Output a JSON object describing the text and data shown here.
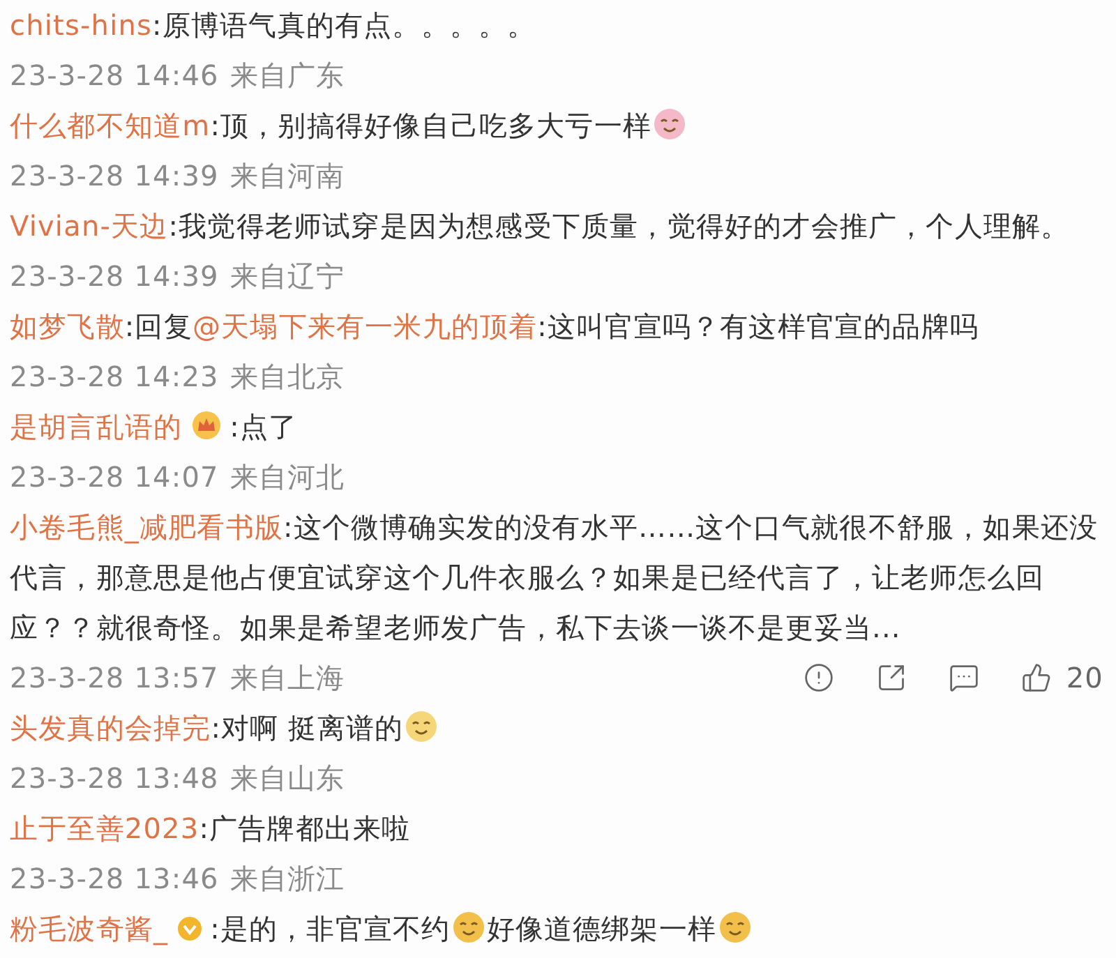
{
  "comments": [
    {
      "user": "chits-hins",
      "content": [
        {
          "kind": "text",
          "text": ":原博语气真的有点。。。。。"
        }
      ],
      "time": "23-3-28 14:46",
      "location": "来自广东"
    },
    {
      "user": "什么都不知道m",
      "content": [
        {
          "kind": "text",
          "text": ":顶，别搞得好像自己吃多大亏一样"
        },
        {
          "kind": "emoji",
          "color": "#f4b8c8"
        }
      ],
      "time": "23-3-28 14:39",
      "location": "来自河南"
    },
    {
      "user": "Vivian-天边",
      "content": [
        {
          "kind": "text",
          "text": ":我觉得老师试穿是因为想感受下质量，觉得好的才会推广，个人理解。"
        }
      ],
      "time": "23-3-28 14:39",
      "location": "来自辽宁"
    },
    {
      "user": "如梦飞散",
      "content": [
        {
          "kind": "text",
          "text": ":回复"
        },
        {
          "kind": "mention",
          "text": "@天塌下来有一米九的顶着"
        },
        {
          "kind": "text",
          "text": ":这叫官宣吗？有这样官宣的品牌吗"
        }
      ],
      "time": "23-3-28 14:23",
      "location": "来自北京"
    },
    {
      "user": "是胡言乱语的",
      "content": [
        {
          "kind": "crown"
        },
        {
          "kind": "text",
          "text": ":点了"
        }
      ],
      "time": "23-3-28 14:07",
      "location": "来自河北"
    },
    {
      "user": "小卷毛熊_减肥看书版",
      "content": [
        {
          "kind": "text",
          "text": ":这个微博确实发的没有水平……这个口气就很不舒服，如果还没代言，那意思是他占便宜试穿这个几件衣服么？如果是已经代言了，让老师怎么回应？？就很奇怪。如果是希望老师发广告，私下去谈一谈不是更妥当..."
        }
      ],
      "time": "23-3-28 13:57",
      "location": "来自上海",
      "actions": {
        "likes": "20"
      }
    },
    {
      "user": "头发真的会掉完",
      "content": [
        {
          "kind": "text",
          "text": ":对啊 挺离谱的"
        },
        {
          "kind": "emoji",
          "color": "#f5d77a"
        }
      ],
      "time": "23-3-28 13:48",
      "location": "来自山东"
    },
    {
      "user": "止于至善2023",
      "content": [
        {
          "kind": "text",
          "text": ":广告牌都出来啦"
        }
      ],
      "time": "23-3-28 13:46",
      "location": "来自浙江"
    },
    {
      "user": "粉毛波奇酱_",
      "content": [
        {
          "kind": "verified"
        },
        {
          "kind": "text",
          "text": ":是的，非官宣不约"
        },
        {
          "kind": "emoji",
          "color": "#f2c04a"
        },
        {
          "kind": "text",
          "text": "好像道德绑架一样"
        },
        {
          "kind": "emoji",
          "color": "#f2c04a"
        }
      ]
    }
  ]
}
